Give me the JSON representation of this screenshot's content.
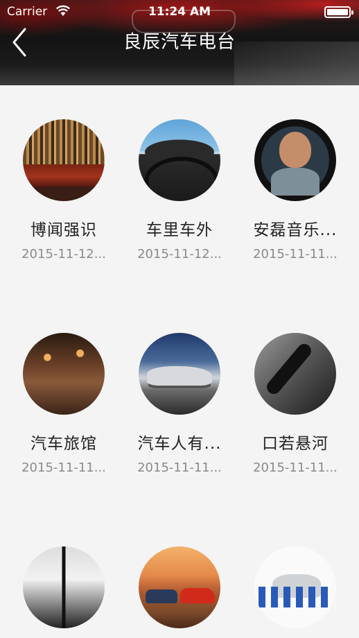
{
  "status_bar": {
    "carrier": "Carrier",
    "time": "11:24 AM"
  },
  "nav": {
    "title": "良辰汽车电台"
  },
  "items": [
    {
      "name": "博闻强识",
      "date": "2015-11-12...",
      "icon": "library-thumbnail"
    },
    {
      "name": "车里车外",
      "date": "2015-11-12...",
      "icon": "steering-wheel-thumbnail"
    },
    {
      "name": "安磊音乐...",
      "date": "2015-11-11...",
      "icon": "music-host-thumbnail"
    },
    {
      "name": "汽车旅馆",
      "date": "2015-11-11...",
      "icon": "hotel-thumbnail"
    },
    {
      "name": "汽车人有...",
      "date": "2015-11-11...",
      "icon": "sports-car-thumbnail"
    },
    {
      "name": "口若悬河",
      "date": "2015-11-11...",
      "icon": "microphone-thumbnail"
    },
    {
      "name": "",
      "date": "",
      "icon": "cafe-thumbnail"
    },
    {
      "name": "",
      "date": "",
      "icon": "cartoon-cars-thumbnail"
    },
    {
      "name": "",
      "date": "",
      "icon": "pit-crew-thumbnail"
    }
  ]
}
